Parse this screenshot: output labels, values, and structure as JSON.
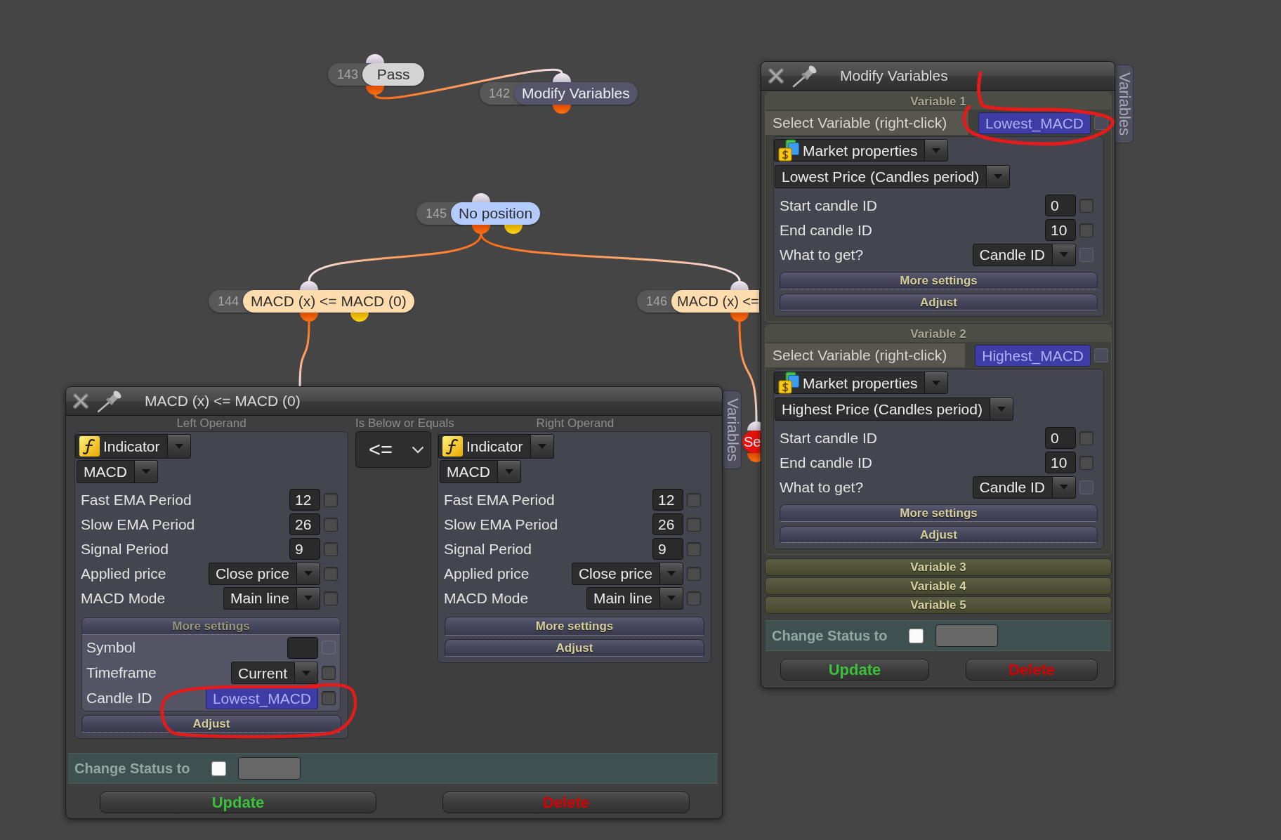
{
  "graph": {
    "nodes": [
      {
        "number": "143",
        "label": "Pass",
        "color": "#d4d4d4",
        "second_output": false,
        "offscreen_link": false,
        "children": [
          {
            "number": "142",
            "label": "Modify Variables",
            "color": "#55546a",
            "second_output": false,
            "offscreen_link": false
          }
        ]
      },
      {
        "number": "145",
        "label": "No position",
        "color": "#b4cbff",
        "second_output": true,
        "offscreen_link": false,
        "children": [
          {
            "number": "144",
            "label": "MACD (x) <= MACD (0)",
            "color": "#ffdcae",
            "second_output": true,
            "offscreen_link": true
          },
          {
            "number": "146",
            "label": "MACD (x) <=",
            "color": "#ffdcae",
            "second_output": false,
            "offscreen_link": false,
            "children": [
              {
                "label": "Se",
                "color": "#e3120e",
                "second_output": false,
                "offscreen_link": false
              }
            ]
          }
        ]
      }
    ]
  },
  "condition_window": {
    "title": "MACD (x) <= MACD (0)",
    "side_tab": "Variables",
    "operator": {
      "heading": "Is Below or Equals",
      "value": "<="
    },
    "operands": [
      {
        "heading": "Left Operand",
        "source": "Indicator",
        "indicator": "MACD",
        "fields": [
          {
            "kind": "number",
            "label": "Fast EMA Period",
            "value": "12",
            "checkbox": {
              "checked": false,
              "disabled": false
            }
          },
          {
            "kind": "number",
            "label": "Slow EMA Period",
            "value": "26",
            "checkbox": {
              "checked": false,
              "disabled": false
            }
          },
          {
            "kind": "number",
            "label": "Signal Period",
            "value": "9",
            "checkbox": {
              "checked": false,
              "disabled": false
            }
          },
          {
            "kind": "combo",
            "label": "Applied price",
            "value": "Close price",
            "checkbox": {
              "checked": false,
              "disabled": false
            }
          },
          {
            "kind": "combo",
            "label": "MACD Mode",
            "value": "Main line",
            "checkbox": {
              "checked": false,
              "disabled": false
            }
          }
        ],
        "more_settings": {
          "label": "More settings",
          "expanded": true,
          "fields": [
            {
              "kind": "text",
              "label": "Symbol",
              "checkbox": {
                "checked": false,
                "disabled": true
              }
            },
            {
              "kind": "combo",
              "label": "Timeframe",
              "value": "Current",
              "checkbox": {
                "checked": false,
                "disabled": false
              }
            },
            {
              "kind": "variable",
              "label": "Candle ID",
              "value": "Lowest_MACD",
              "checkbox": {
                "checked": false,
                "disabled": false
              }
            }
          ]
        },
        "adjust": "Adjust"
      },
      {
        "heading": "Right Operand",
        "source": "Indicator",
        "indicator": "MACD",
        "fields": [
          {
            "kind": "number",
            "label": "Fast EMA Period",
            "value": "12",
            "checkbox": {
              "checked": false,
              "disabled": false
            }
          },
          {
            "kind": "number",
            "label": "Slow EMA Period",
            "value": "26",
            "checkbox": {
              "checked": false,
              "disabled": false
            }
          },
          {
            "kind": "number",
            "label": "Signal Period",
            "value": "9",
            "checkbox": {
              "checked": false,
              "disabled": false
            }
          },
          {
            "kind": "combo",
            "label": "Applied price",
            "value": "Close price",
            "checkbox": {
              "checked": false,
              "disabled": false
            }
          },
          {
            "kind": "combo",
            "label": "MACD Mode",
            "value": "Main line",
            "checkbox": {
              "checked": false,
              "disabled": false
            }
          }
        ],
        "more_settings": {
          "label": "More settings",
          "expanded": false
        },
        "adjust": "Adjust"
      }
    ],
    "status": {
      "label": "Change Status to",
      "checked": false
    },
    "buttons": [
      {
        "kind": "update",
        "label": "Update"
      },
      {
        "kind": "delete",
        "label": "Delete"
      }
    ]
  },
  "variables_window": {
    "title": "Modify Variables",
    "side_tab": "Variables",
    "variables": [
      {
        "title": "Variable 1",
        "expanded": true,
        "select": {
          "label": "Select Variable (right-click)",
          "value": "Lowest_MACD",
          "checkbox": {
            "checked": false,
            "disabled": true
          }
        },
        "source": "Market properties",
        "property": "Lowest Price (Candles period)",
        "fields": [
          {
            "kind": "number",
            "label": "Start candle ID",
            "value": "0",
            "checkbox": {
              "checked": false,
              "disabled": false
            }
          },
          {
            "kind": "number",
            "label": "End candle ID",
            "value": "10",
            "checkbox": {
              "checked": false,
              "disabled": false
            }
          },
          {
            "kind": "combo",
            "label": "What to get?",
            "value": "Candle ID",
            "checkbox": {
              "checked": false,
              "disabled": true
            }
          }
        ],
        "more_settings": {
          "label": "More settings",
          "expanded": false
        },
        "adjust": "Adjust"
      },
      {
        "title": "Variable 2",
        "expanded": true,
        "select": {
          "label": "Select Variable (right-click)",
          "value": "Highest_MACD",
          "checkbox": {
            "checked": false,
            "disabled": true
          }
        },
        "source": "Market properties",
        "property": "Highest Price (Candles period)",
        "fields": [
          {
            "kind": "number",
            "label": "Start candle ID",
            "value": "0",
            "checkbox": {
              "checked": false,
              "disabled": false
            }
          },
          {
            "kind": "number",
            "label": "End candle ID",
            "value": "10",
            "checkbox": {
              "checked": false,
              "disabled": false
            }
          },
          {
            "kind": "combo",
            "label": "What to get?",
            "value": "Candle ID",
            "checkbox": {
              "checked": false,
              "disabled": true
            }
          }
        ],
        "more_settings": {
          "label": "More settings",
          "expanded": false
        },
        "adjust": "Adjust"
      },
      {
        "title": "Variable 3",
        "expanded": false
      },
      {
        "title": "Variable 4",
        "expanded": false
      },
      {
        "title": "Variable 5",
        "expanded": false
      }
    ],
    "status": {
      "label": "Change Status to",
      "checked": false
    },
    "buttons": [
      {
        "kind": "update",
        "label": "Update"
      },
      {
        "kind": "delete",
        "label": "Delete"
      }
    ]
  }
}
